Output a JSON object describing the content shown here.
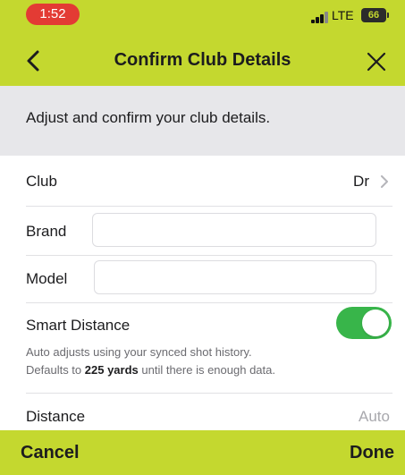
{
  "status_bar": {
    "time": "1:52",
    "network": "LTE",
    "battery": "66"
  },
  "nav": {
    "title": "Confirm Club Details"
  },
  "intro": {
    "text": "Adjust and confirm your club details."
  },
  "club": {
    "label": "Club",
    "value": "Dr"
  },
  "brand": {
    "label": "Brand",
    "value": ""
  },
  "model": {
    "label": "Model",
    "value": ""
  },
  "smart_distance": {
    "label": "Smart Distance",
    "enabled": true,
    "help_line1": "Auto adjusts using your synced shot history.",
    "help_line2_prefix": "Defaults to ",
    "help_line2_value": "225 yards",
    "help_line2_suffix": " until there is enough data."
  },
  "distance": {
    "label": "Distance",
    "value": "Auto"
  },
  "bottom_bar": {
    "cancel_label": "Cancel",
    "done_label": "Done"
  },
  "colors": {
    "brand": "#c4d82f",
    "toggle_on": "#38b54a",
    "time_pill": "#e33b34",
    "intro_bg": "#e7e7ea"
  }
}
